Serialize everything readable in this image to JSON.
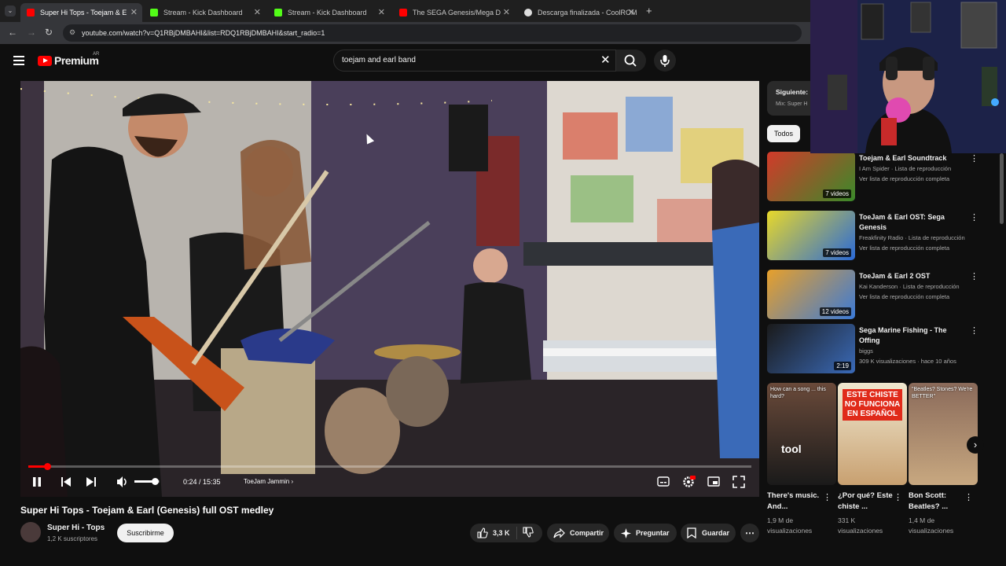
{
  "browser": {
    "tabs": [
      {
        "title": "Super Hi Tops - Toejam & E",
        "active": true,
        "favicon_color": "#ff0000"
      },
      {
        "title": "Stream - Kick Dashboard",
        "active": false,
        "favicon_color": "#53fc18"
      },
      {
        "title": "Stream - Kick Dashboard",
        "active": false,
        "favicon_color": "#53fc18"
      },
      {
        "title": "The SEGA Genesis/Mega D",
        "active": false,
        "favicon_color": "#ff0000"
      },
      {
        "title": "Descarga finalizada - CoolROM",
        "active": false,
        "favicon_color": "#dddddd"
      }
    ],
    "url": "youtube.com/watch?v=Q1RBjDMBAHI&list=RDQ1RBjDMBAHI&start_radio=1"
  },
  "header": {
    "logo_text": "Premium",
    "region": "AR",
    "search_value": "toejam and earl band"
  },
  "player": {
    "current_time": "0:24 / 15:35",
    "chapter": "ToeJam Jammin",
    "progress": 0.026,
    "volume": 0.8
  },
  "video": {
    "title": "Super Hi Tops - Toejam & Earl (Genesis) full OST medley",
    "channel": "Super Hi - Tops",
    "subscribers": "1,2 K suscriptores",
    "subscribe_label": "Suscribirme",
    "likes": "3,3 K",
    "share_label": "Compartir",
    "ask_label": "Preguntar",
    "save_label": "Guardar"
  },
  "sidebar": {
    "next_label": "Siguiente:",
    "next_mix": "Mix: Super H",
    "chip_all": "Todos",
    "items": [
      {
        "title": "Toejam & Earl Soundtrack",
        "meta1": "I Am Spider · Lista de reproducción",
        "meta2": "Ver lista de reproducción completa",
        "badge": "7 videos",
        "colors": [
          "#d23a2a",
          "#3a8a2a"
        ]
      },
      {
        "title": "ToeJam & Earl OST: Sega Genesis",
        "meta1": "Freakfinity Radio · Lista de reproducción",
        "meta2": "Ver lista de reproducción completa",
        "badge": "7 videos",
        "colors": [
          "#e8d82a",
          "#2a6ad8"
        ]
      },
      {
        "title": "ToeJam & Earl 2 OST",
        "meta1": "Kai Kanderson · Lista de reproducción",
        "meta2": "Ver lista de reproducción completa",
        "badge": "12 videos",
        "colors": [
          "#e8a02a",
          "#3a7ad8"
        ]
      },
      {
        "title": "Sega Marine Fishing - The Offing",
        "meta1": "biggs",
        "meta2": "309 K visualizaciones · hace 10 años",
        "badge": "2:19",
        "colors": [
          "#1a1a1a",
          "#3a6ab8"
        ]
      }
    ],
    "shorts": [
      {
        "title": "There's music. And...",
        "views": "1,9 M de visualizaciones",
        "overlay": "How can a song ... this hard?",
        "logo": "tool",
        "colors": [
          "#6a4a3a",
          "#1a1a1a"
        ]
      },
      {
        "title": "¿Por qué? Este chiste ...",
        "views": "331 K visualizaciones",
        "overlay": "ESTE CHISTE NO FUNCIONA EN ESPAÑOL",
        "logo": "",
        "colors": [
          "#f0e8d0",
          "#c8a070"
        ]
      },
      {
        "title": "Bon Scott: Beatles? ...",
        "views": "1,4 M de visualizaciones",
        "overlay": "\"Beatles? Stones? We're BETTER\"",
        "logo": "",
        "colors": [
          "#8a6a5a",
          "#c8a880"
        ]
      }
    ]
  }
}
